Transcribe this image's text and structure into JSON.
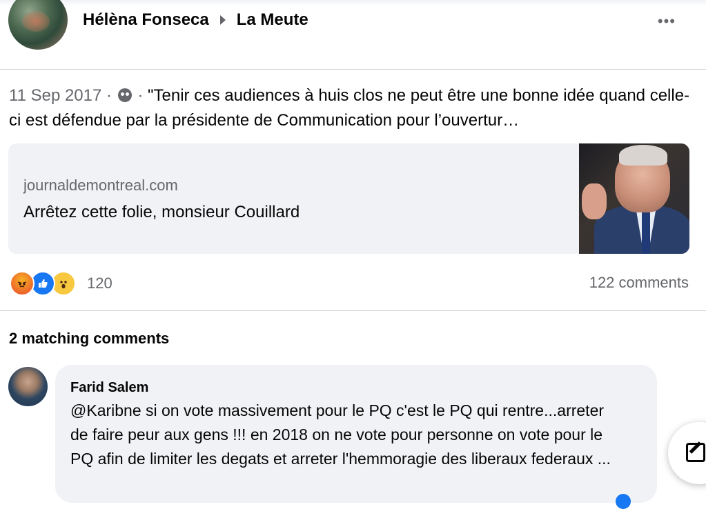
{
  "post": {
    "author": "Hélèna Fonseca",
    "group": "La Meute",
    "more_label": "•••",
    "date": "11 Sep 2017",
    "separator": " · ",
    "text": "\"Tenir ces audiences à huis clos ne peut être une bonne idée quand celle-ci est défendue par la présidente de Communication pour l’ouvertur…",
    "link": {
      "domain": "journaldemontreal.com",
      "title": "Arrêtez cette folie, monsieur Couillard"
    },
    "reactions": {
      "icons": [
        "angry-icon",
        "like-icon",
        "wow-icon"
      ],
      "count": "120"
    },
    "comments_count": "122 comments"
  },
  "matching": {
    "heading": "2 matching comments",
    "comments": [
      {
        "author": "Farid Salem",
        "text": "@Karibne si on vote massivement pour le PQ c'est le PQ qui rentre...arreter de faire peur aux gens !!! en 2018 on ne vote pour personne on vote pour le PQ afin de limiter les degats et arreter l'hemmoragie des liberaux federaux ..."
      }
    ]
  },
  "colors": {
    "secondary_text": "#65676b",
    "card_bg": "#f0f2f5",
    "like_blue": "#1877f2"
  }
}
